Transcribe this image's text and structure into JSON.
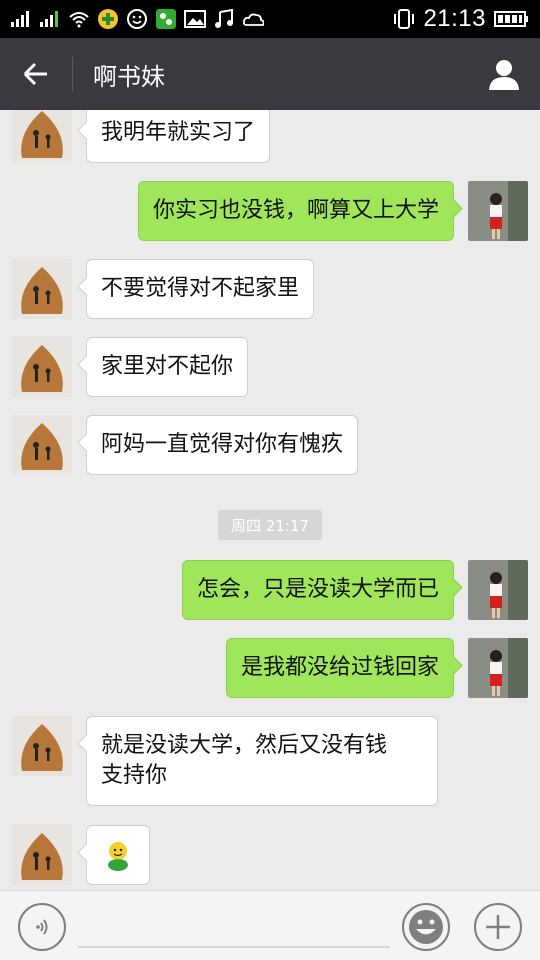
{
  "status_bar": {
    "time": "21:13"
  },
  "title_bar": {
    "title": "啊书妹"
  },
  "messages": [
    {
      "side": "left",
      "text": "我明年就实习了"
    },
    {
      "side": "right",
      "text": "你实习也没钱，啊算又上大学"
    },
    {
      "side": "left",
      "text": "不要觉得对不起家里"
    },
    {
      "side": "left",
      "text": "家里对不起你"
    },
    {
      "side": "left",
      "text": "阿妈一直觉得对你有愧疚"
    },
    {
      "side": "right",
      "text": "怎会，只是没读大学而已"
    },
    {
      "side": "right",
      "text": "是我都没给过钱回家"
    },
    {
      "side": "left",
      "text": "就是没读大学，然后又没有钱\n支持你"
    },
    {
      "side": "left",
      "text": "",
      "emoji": "smiley-sticker"
    }
  ],
  "timestamp": "周四 21:17",
  "colors": {
    "sent_bubble": "#9fe65b",
    "received_bubble": "#ffffff",
    "title_bar": "#393a3f",
    "background": "#ebebeb"
  }
}
